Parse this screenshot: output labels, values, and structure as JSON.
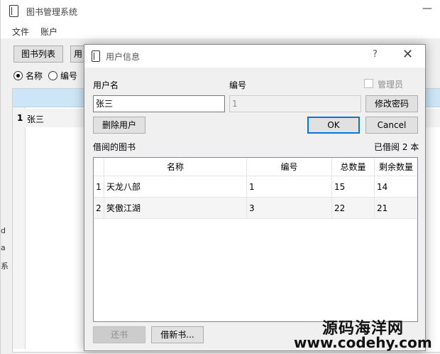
{
  "main_window": {
    "title": "图书管理系统",
    "menu": [
      "文件",
      "账户"
    ],
    "toolbar": {
      "book_list": "图书列表",
      "partial_tab": "用"
    },
    "search_options": [
      "名称",
      "编号"
    ],
    "table_rows": [
      {
        "num": "1",
        "name": "张三"
      }
    ],
    "side_fragments": [
      "d",
      "a",
      "系"
    ]
  },
  "dialog": {
    "title": "用户信息",
    "help_label": "?",
    "close_label": "✕",
    "username_label": "用户名",
    "id_label": "编号",
    "admin_label": "管理员",
    "username_value": "张三",
    "id_value": "1",
    "change_password_label": "修改密码",
    "delete_user_label": "删除用户",
    "ok_label": "OK",
    "cancel_label": "Cancel",
    "borrowed_label": "借阅的图书",
    "borrowed_count": "已借阅 2 本",
    "return_label": "还书",
    "borrow_new_label": "借新书...",
    "table": {
      "headers": [
        "名称",
        "编号",
        "总数量",
        "剩余数量"
      ],
      "rows": [
        {
          "num": "1",
          "name": "天龙八部",
          "id": "1",
          "total": "15",
          "remain": "14"
        },
        {
          "num": "2",
          "name": "笑傲江湖",
          "id": "3",
          "total": "22",
          "remain": "21"
        }
      ]
    }
  },
  "watermark": {
    "line1": "源码海洋网",
    "line2": "www.codehy.com"
  }
}
